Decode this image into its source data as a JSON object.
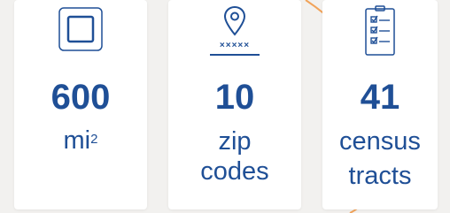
{
  "colors": {
    "accent": "#1f4f96",
    "curve": "#f1a35a",
    "card": "#ffffff",
    "background": "#f2f1ef"
  },
  "stats": [
    {
      "icon": "square-area-icon",
      "value": "600",
      "label_main": "mi",
      "label_sup": "2"
    },
    {
      "icon": "map-pin-icon",
      "icon_caption": "×××××",
      "value": "10",
      "label_line1": "zip",
      "label_line2": "codes"
    },
    {
      "icon": "checklist-clipboard-icon",
      "value": "41",
      "label_line1": "census",
      "label_line2": "tracts"
    }
  ]
}
